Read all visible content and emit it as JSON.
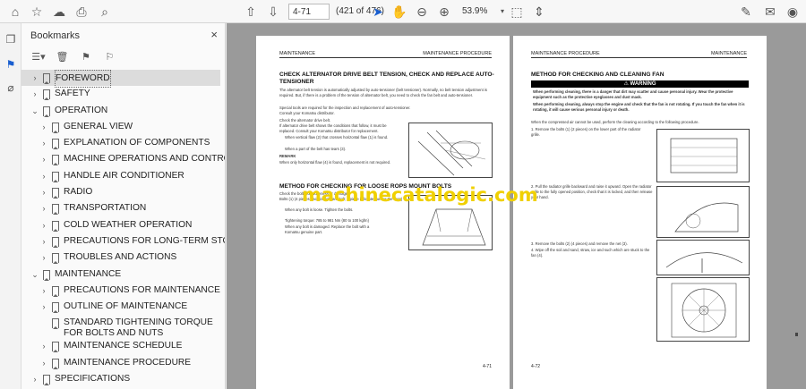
{
  "toolbar": {
    "page_current": "4-71",
    "page_status": "(421 of 476)",
    "zoom": "53.9%",
    "icons": [
      "home-icon",
      "star-icon",
      "cloud-upload-icon",
      "print-icon",
      "search-icon",
      "up-arrow-icon",
      "down-arrow-icon",
      "cursor-icon",
      "hand-icon",
      "zoom-out-icon",
      "zoom-in-icon",
      "fit-page-icon",
      "scroll-mode-icon",
      "sign-icon",
      "mail-icon",
      "user-icon"
    ]
  },
  "panel": {
    "title": "Bookmarks",
    "close": "×"
  },
  "bookmarks": [
    {
      "label": "FOREWORD",
      "level": 0,
      "expanded": false,
      "selected": true
    },
    {
      "label": "SAFETY",
      "level": 0,
      "expanded": false
    },
    {
      "label": "OPERATION",
      "level": 0,
      "expanded": true
    },
    {
      "label": "GENERAL VIEW",
      "level": 1,
      "expanded": false
    },
    {
      "label": "EXPLANATION OF COMPONENTS",
      "level": 1,
      "expanded": false
    },
    {
      "label": "MACHINE OPERATIONS AND CONTROLS",
      "level": 1,
      "expanded": false
    },
    {
      "label": "HANDLE AIR CONDITIONER",
      "level": 1,
      "expanded": false
    },
    {
      "label": "RADIO",
      "level": 1,
      "expanded": false
    },
    {
      "label": "TRANSPORTATION",
      "level": 1,
      "expanded": false
    },
    {
      "label": "COLD WEATHER OPERATION",
      "level": 1,
      "expanded": false
    },
    {
      "label": "PRECAUTIONS FOR LONG-TERM STORAGE",
      "level": 1,
      "expanded": false
    },
    {
      "label": "TROUBLES AND ACTIONS",
      "level": 1,
      "expanded": false
    },
    {
      "label": "MAINTENANCE",
      "level": 0,
      "expanded": true
    },
    {
      "label": "PRECAUTIONS FOR MAINTENANCE",
      "level": 1,
      "expanded": false
    },
    {
      "label": "OUTLINE OF MAINTENANCE",
      "level": 1,
      "expanded": false
    },
    {
      "label": "STANDARD TIGHTENING TORQUE FOR BOLTS AND NUTS",
      "level": 1,
      "leaf": true
    },
    {
      "label": "MAINTENANCE SCHEDULE",
      "level": 1,
      "expanded": false
    },
    {
      "label": "MAINTENANCE PROCEDURE",
      "level": 1,
      "expanded": false
    },
    {
      "label": "SPECIFICATIONS",
      "level": 0,
      "expanded": false
    }
  ],
  "page_left": {
    "header_left": "MAINTENANCE",
    "header_right": "MAINTENANCE PROCEDURE",
    "heading1": "CHECK ALTERNATOR DRIVE BELT TENSION, CHECK AND REPLACE AUTO-TENSIONER",
    "para1": "The alternator belt tension is automatically adjusted by auto-tensioner (belt tensioner). Normally, no belt tension adjustment is required. But, if there is a problem of the tension of alternator belt, you need to check the fan belt and auto-tensioner.",
    "para2": "Special tools are required for the inspection and replacement of auto-tensioner.",
    "para3": "Consult your Komatsu distributor.",
    "para4": "Check the alternator drive belt.",
    "para5": "If alternator drive belt shows the conditions that follow, it must be replaced. Consult your Komatsu distributor for replacement.",
    "bullet1": "When vertical flaw (2) that crosses horizontal flaw (1) is found.",
    "bullet2": "When a part of the belt has tears (3).",
    "remark": "REMARK",
    "remark_text": "When only horizontal flaw (4) is found, replacement is not required.",
    "heading2": "METHOD FOR CHECKING FOR LOOSE ROPS MOUNT BOLTS",
    "para6": "Check the bolts for looseness or damage.",
    "para7": "Bolts (1) (4 pieces each of right and left; 1 piece is located under the floor)",
    "bullet3": "When any bolt is loose. Tighten the bolts.",
    "bullet3b": "Tightening torque: 785 to 981 Nm {80 to 100 kgfm}",
    "bullet4": "When any bolt is damaged. Replace the bolt with a Komatsu genuine part.",
    "page_number": "4-71"
  },
  "page_right": {
    "header_left": "MAINTENANCE PROCEDURE",
    "header_right": "MAINTENANCE",
    "heading1": "METHOD FOR CHECKING AND CLEANING FAN",
    "warning": "WARNING",
    "warn1": "When performing cleaning, there is a danger that dirt may scatter and cause personal injury. Wear the protective equipment such as the protective eyeglasses and dust mask.",
    "warn2": "When performing cleaning, always stop the engine and check that the fan is not rotating. If you touch the fan when it is rotating, it will cause serious personal injury or death.",
    "intro": "When the compressed air cannot be used, perform the cleaning according to the following procedure.",
    "step1": "1. Remove the bolts (1) (2 pieces) on the lower part of the radiator grille.",
    "step2": "2. Pull the radiator grille backward and raise it upward. Open the radiator grille to the fully opened position, check that it is locked, and then release your hand.",
    "step3": "3. Remove the bolts (2) (4 pieces) and remove the net (3).",
    "step4": "4. Wipe off the soil and sand, straw, ice and such which are stuck to the fan (4).",
    "page_number": "4-72"
  },
  "watermark": "machinecatalogic.com"
}
